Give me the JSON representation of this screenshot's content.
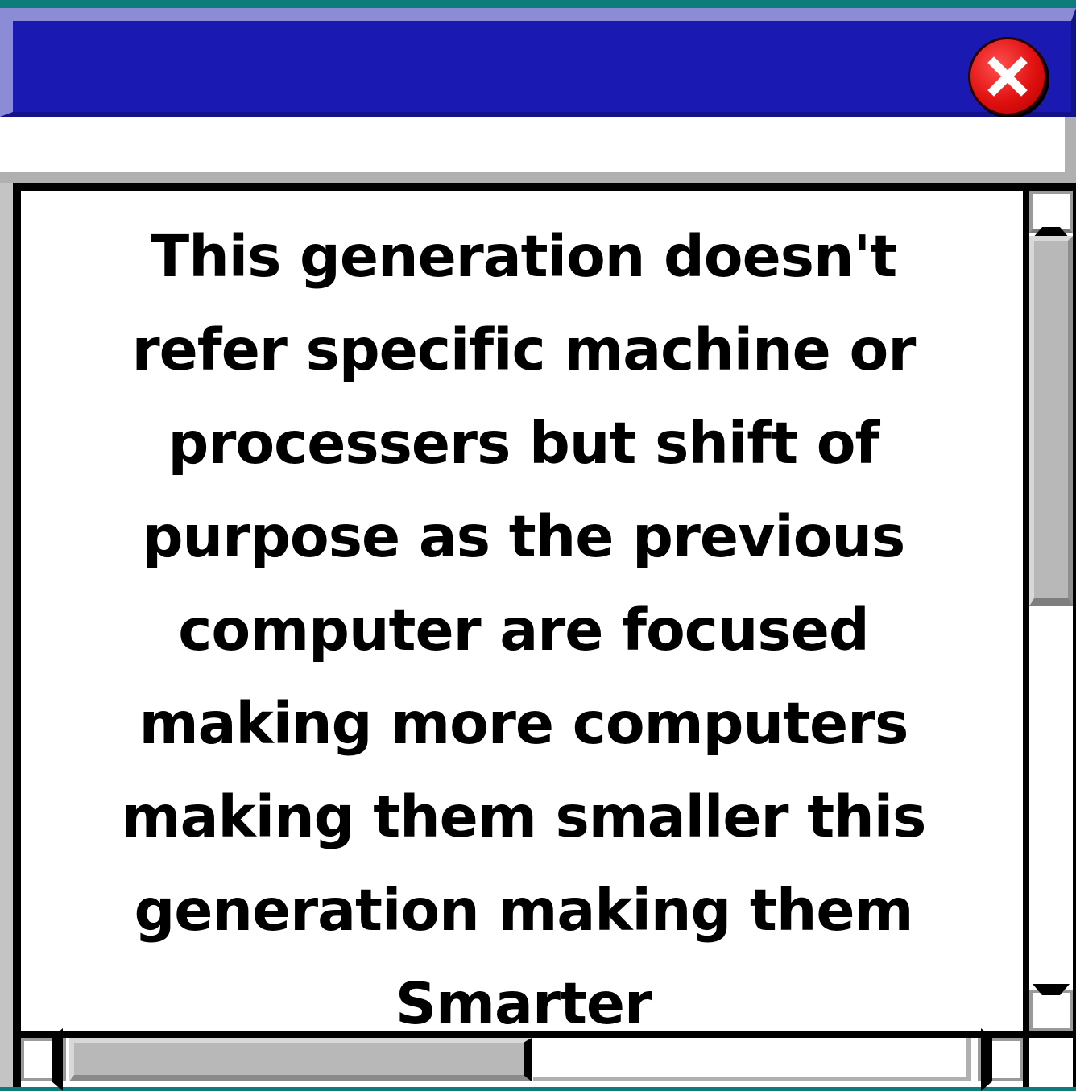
{
  "window": {
    "title": "",
    "message_lines": [
      "This generation doesn't",
      "refer specific machine or",
      "processers but shift of",
      "purpose as the previous",
      "computer are focused",
      "making more computers",
      "making them smaller this",
      "generation making them",
      "Smarter"
    ]
  },
  "icons": {
    "close": "close-icon",
    "scroll_up": "arrow-up-icon",
    "scroll_down": "arrow-down-icon",
    "scroll_left": "arrow-left-icon",
    "scroll_right": "arrow-right-icon"
  },
  "colors": {
    "titlebar": "#1a1ab3",
    "titlebar_highlight": "#8b8bd6",
    "close_button": "#e01010",
    "desktop": "#0e7c7b",
    "content_background": "#ffffff",
    "text": "#000000"
  },
  "scroll": {
    "vertical_position": 0.0,
    "horizontal_position": 0.0
  }
}
